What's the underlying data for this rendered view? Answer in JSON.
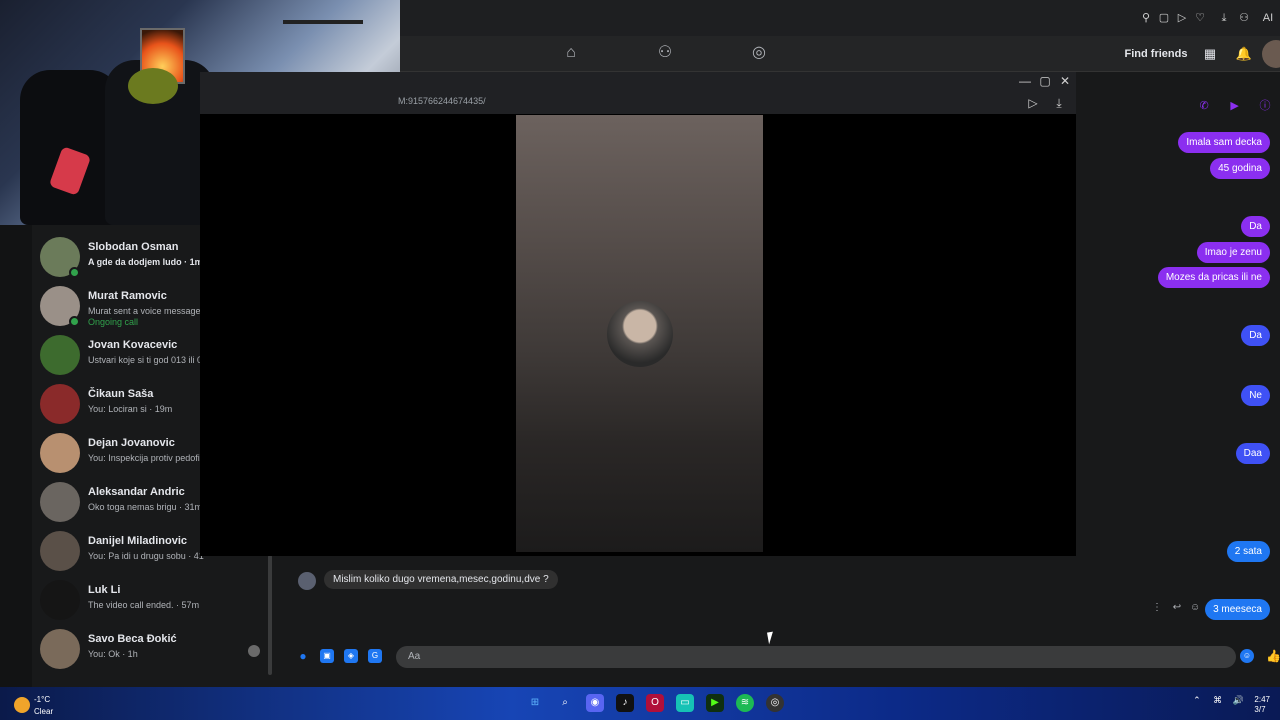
{
  "browser": {
    "toolbar_icons": [
      "pin-icon",
      "square-icon",
      "play-icon",
      "heart-icon",
      "download-icon",
      "account-icon",
      "tag-icon"
    ],
    "ai_label": "AI"
  },
  "fb_nav": {
    "find_friends": "Find friends",
    "home_icon": "home-icon",
    "friends_icon": "friends-icon",
    "groups_icon": "groups-icon"
  },
  "call_window": {
    "url": "M:915766244674435/",
    "minimize": "—",
    "maximize": "▢",
    "close": "✕"
  },
  "chat_list": [
    {
      "name": "Slobodan Osman",
      "preview": "A gde da dodjem ludo · 1m",
      "bold": true,
      "online": true,
      "color": "#6b7b5a"
    },
    {
      "name": "Murat Ramovic",
      "preview": "Murat sent a voice message. ·",
      "extra": "Ongoing call",
      "online": true,
      "color": "#9a9088"
    },
    {
      "name": "Jovan Kovacevic",
      "preview": "Ustvari koje si ti god 013 ili 0'",
      "color": "#3d6b2e"
    },
    {
      "name": "Čikaun Saša",
      "preview": "You: Lociran si · 19m",
      "color": "#8a2a2a"
    },
    {
      "name": "Dejan Jovanovic",
      "preview": "You: Inspekcija protiv pedofili",
      "color": "#b89070"
    },
    {
      "name": "Aleksandar Andric",
      "preview": "Oko toga nemas brigu · 31m",
      "color": "#6a6560"
    },
    {
      "name": "Danijel Miladinovic",
      "preview": "You: Pa idi u drugu sobu · 41m",
      "color": "#5a5048"
    },
    {
      "name": "Luk Li",
      "preview": "The video call ended. · 57m",
      "color": "#151515"
    },
    {
      "name": "Savo Beca Đokić",
      "preview": "You: Ok · 1h",
      "color": "#7a6a5a",
      "seen": true
    }
  ],
  "messages_out": [
    {
      "text": "Imala sam decka",
      "style": "purple"
    },
    {
      "text": "45 godina",
      "style": "purple"
    },
    {
      "text": "Da",
      "style": "purple"
    },
    {
      "text": "Imao je zenu",
      "style": "purple"
    },
    {
      "text": "Mozes da pricas ili ne",
      "style": "purple"
    },
    {
      "text": "Da",
      "style": "indigo"
    },
    {
      "text": "Ne",
      "style": "indigo"
    },
    {
      "text": "Daa",
      "style": "indigo"
    },
    {
      "text": "2 sata",
      "style": "blue"
    },
    {
      "text": "3 meeseca",
      "style": "blue"
    }
  ],
  "message_in": "Mislim koliko dugo vremena,mesec,godinu,dve ?",
  "composer": {
    "placeholder": "Aa"
  },
  "taskbar": {
    "temperature": "-1°C",
    "condition": "Clear",
    "time": "2:47",
    "date": "3/7"
  },
  "colors": {
    "messenger_purple": "#8b2ff0",
    "messenger_blue": "#1f77f2",
    "online_green": "#31a24c"
  }
}
